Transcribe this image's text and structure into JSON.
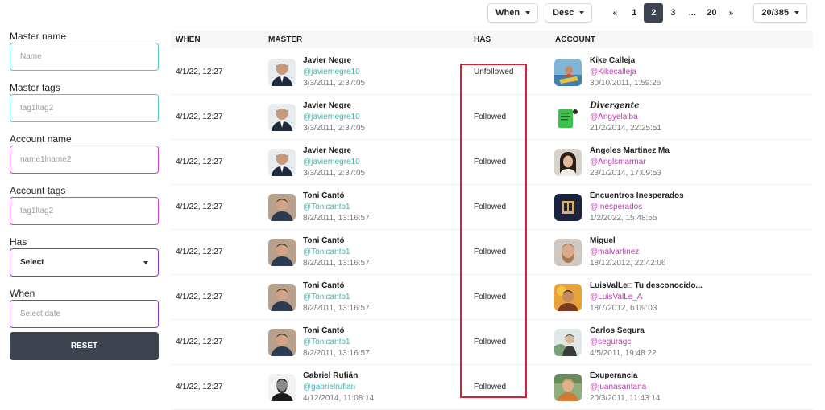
{
  "toolbar": {
    "when_dropdown": "When",
    "order_dropdown": "Desc",
    "pagination": {
      "first": "«",
      "pages": [
        "1",
        "2",
        "3"
      ],
      "active": "2",
      "ellipsis": "...",
      "last_page": "20",
      "last": "»"
    },
    "per_page": "20/385"
  },
  "filters": {
    "master_name": {
      "label": "Master name",
      "placeholder": "Name"
    },
    "master_tags": {
      "label": "Master tags",
      "placeholder": "tag1ltag2"
    },
    "account_name": {
      "label": "Account name",
      "placeholder": "name1lname2"
    },
    "account_tags": {
      "label": "Account tags",
      "placeholder": "tag1ltag2"
    },
    "has": {
      "label": "Has",
      "value": "Select"
    },
    "when": {
      "label": "When",
      "placeholder": "Select date"
    },
    "reset_label": "RESET"
  },
  "table": {
    "headers": {
      "when": "WHEN",
      "master": "MASTER",
      "has": "HAS",
      "account": "ACCOUNT"
    },
    "rows": [
      {
        "when": "4/1/22, 12:27",
        "master": {
          "name": "Javier Negre",
          "handle": "@javiernegre10",
          "date": "3/3/2011, 2:37:05"
        },
        "has": "Unfollowed",
        "account": {
          "name": "Kike Calleja",
          "handle": "@Kikecalleja",
          "date": "30/10/2011, 1:59:26"
        }
      },
      {
        "when": "4/1/22, 12:27",
        "master": {
          "name": "Javier Negre",
          "handle": "@javiernegre10",
          "date": "3/3/2011, 2:37:05"
        },
        "has": "Followed",
        "account": {
          "name": "Divergente",
          "handle": "@Angyelalba",
          "date": "21/2/2014, 22:25:51"
        }
      },
      {
        "when": "4/1/22, 12:27",
        "master": {
          "name": "Javier Negre",
          "handle": "@javiernegre10",
          "date": "3/3/2011, 2:37:05"
        },
        "has": "Followed",
        "account": {
          "name": "Angeles Martinez Ma",
          "handle": "@Anglsmarmar",
          "date": "23/1/2014, 17:09:53"
        }
      },
      {
        "when": "4/1/22, 12:27",
        "master": {
          "name": "Toni Cantó",
          "handle": "@Tonicanto1",
          "date": "8/2/2011, 13:16:57"
        },
        "has": "Followed",
        "account": {
          "name": "Encuentros Inesperados",
          "handle": "@Inesperados",
          "date": "1/2/2022, 15:48:55"
        }
      },
      {
        "when": "4/1/22, 12:27",
        "master": {
          "name": "Toni Cantó",
          "handle": "@Tonicanto1",
          "date": "8/2/2011, 13:16:57"
        },
        "has": "Followed",
        "account": {
          "name": "Miguel",
          "handle": "@malvartinez",
          "date": "18/12/2012, 22:42:06"
        }
      },
      {
        "when": "4/1/22, 12:27",
        "master": {
          "name": "Toni Cantó",
          "handle": "@Tonicanto1",
          "date": "8/2/2011, 13:16:57"
        },
        "has": "Followed",
        "account": {
          "name": "LuisValLe□ Tu desconocido...",
          "handle": "@LuisValLe_A",
          "date": "18/7/2012, 6:09:03"
        }
      },
      {
        "when": "4/1/22, 12:27",
        "master": {
          "name": "Toni Cantó",
          "handle": "@Tonicanto1",
          "date": "8/2/2011, 13:16:57"
        },
        "has": "Followed",
        "account": {
          "name": "Carlos Segura",
          "handle": "@seguragc",
          "date": "4/5/2011, 19:48:22"
        }
      },
      {
        "when": "4/1/22, 12:27",
        "master": {
          "name": "Gabriel Rufián",
          "handle": "@gabrielrufian",
          "date": "4/12/2014, 11:08:14"
        },
        "has": "Followed",
        "account": {
          "name": "Exuperancia",
          "handle": "@juanasantana",
          "date": "20/3/2011, 11:43:14"
        }
      }
    ]
  },
  "colors": {
    "teal": "#4ec9c9",
    "pink": "#d13ec9",
    "purple": "#8b36c9",
    "dark": "#3d4450",
    "highlight": "#e11d38"
  },
  "icons": [
    "chevron-down-icon"
  ]
}
